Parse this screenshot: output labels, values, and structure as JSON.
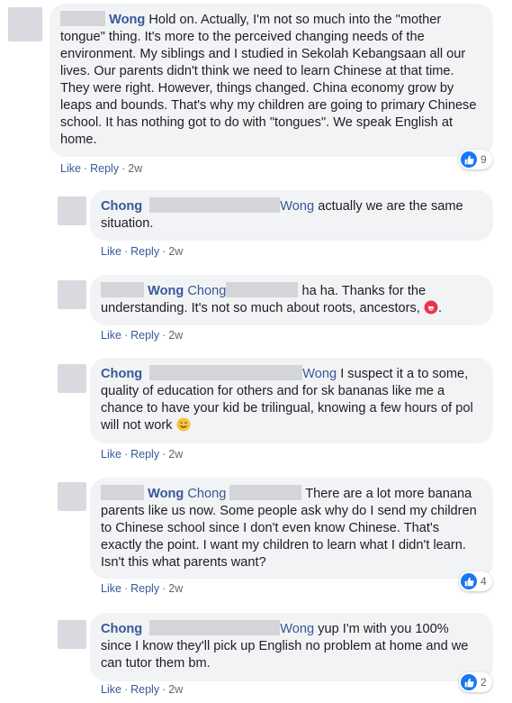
{
  "comments": [
    {
      "name": "Wong",
      "text": "Hold on. Actually, I'm not so much into the \"mother tongue\" thing. It's more to the perceived changing needs of the environment. My siblings and I studied in Sekolah Kebangsaan all our lives. Our parents didn't think we need to learn Chinese at that time. They were right. However, things changed. China economy grow by leaps and bounds. That's why my children are going to primary Chinese school. It has nothing got to do with \"tongues\". We speak English at home.",
      "like": "Like",
      "reply": "Reply",
      "time": "2w",
      "reactions": "9"
    },
    {
      "name": "Chong",
      "tag": "Wong",
      "text": "actually we are the same situation.",
      "like": "Like",
      "reply": "Reply",
      "time": "2w"
    },
    {
      "name": "Wong",
      "tag": "Chong",
      "text": "ha ha. Thanks for the understanding. It's not so much about roots, ancestors,",
      "text_end": ".",
      "emoji": "tongue-out-emoji",
      "like": "Like",
      "reply": "Reply",
      "time": "2w"
    },
    {
      "name": "Chong",
      "tag": "Wong",
      "text": "I suspect it a to some, quality of education for others and for sk bananas like me a chance to have your kid be trilingual, knowing a few hours of pol will not work",
      "emoji": "smiling-emoji",
      "like": "Like",
      "reply": "Reply",
      "time": "2w"
    },
    {
      "name": "Wong",
      "tag": "Chong",
      "text": "There are a lot more banana parents like us now. Some people ask why do I send my children to Chinese school since I don't even know Chinese. That's exactly the point. I want my children to learn what I didn't learn. Isn't this what parents want?",
      "like": "Like",
      "reply": "Reply",
      "time": "2w",
      "reactions": "4"
    },
    {
      "name": "Chong",
      "tag": "Wong",
      "text": "yup I'm with you 100% since I know they'll pick up English no problem at home and we can tutor them bm.",
      "like": "Like",
      "reply": "Reply",
      "time": "2w",
      "reactions": "2"
    }
  ],
  "separator": "·",
  "colors": {
    "link": "#385898",
    "bubble": "#f2f3f5",
    "like_blue": "#1877f2",
    "meta": "#606770"
  }
}
